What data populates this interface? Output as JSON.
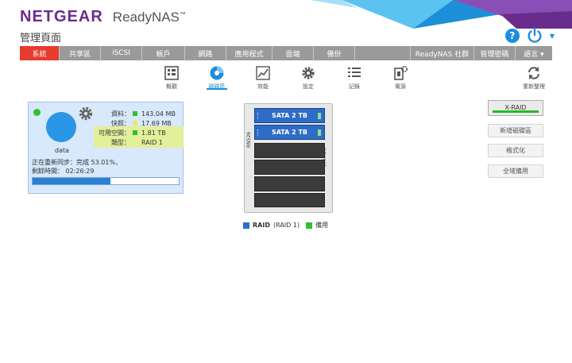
{
  "brand": {
    "logo": "NETGEAR",
    "product": "ReadyNAS",
    "tm": "™"
  },
  "page_title": "管理頁面",
  "colors": {
    "accent": "#e63b2e",
    "brand": "#6a2c8c",
    "blue": "#1b8de0",
    "green": "#2fc12f"
  },
  "nav": {
    "tabs": [
      {
        "label": "系統",
        "active": true
      },
      {
        "label": "共享區"
      },
      {
        "label": "iSCSI"
      },
      {
        "label": "帳戶"
      },
      {
        "label": "網路"
      },
      {
        "label": "應用程式"
      },
      {
        "label": "雲端"
      },
      {
        "label": "備份"
      }
    ],
    "right_tabs": [
      {
        "label": "ReadyNAS 社群"
      },
      {
        "label": "管理密碼"
      },
      {
        "label": "語言 ▾"
      }
    ]
  },
  "subnav": {
    "items": [
      {
        "label": "概觀",
        "icon": "overview-icon"
      },
      {
        "label": "磁碟區",
        "icon": "volume-icon",
        "active": true
      },
      {
        "label": "效能",
        "icon": "performance-icon"
      },
      {
        "label": "設定",
        "icon": "settings-icon"
      },
      {
        "label": "記錄",
        "icon": "logs-icon"
      },
      {
        "label": "電源",
        "icon": "power-settings-icon"
      }
    ],
    "refresh_label": "重新整理"
  },
  "volume": {
    "name": "data",
    "stats": [
      {
        "key": "資料：",
        "value": "143.04 MB",
        "color": "#2fc12f"
      },
      {
        "key": "快照：",
        "value": "17.69 MB",
        "color": "#e8e86a"
      },
      {
        "key": "可用空間：",
        "value": "1.81 TB",
        "color": "#2fc12f"
      },
      {
        "key": "類型：",
        "value": "RAID 1"
      }
    ],
    "sync_line1": "正在重新同步：完成 53.01%，",
    "sync_line2": "剩餘時間： 02:26:29",
    "progress": 0.5301
  },
  "chassis": {
    "model": "RN526",
    "side": "Internal",
    "disks": [
      "SATA 2 TB",
      "SATA 2 TB"
    ],
    "empty_bays": 4
  },
  "legend": {
    "raid_label": "RAID",
    "raid_paren": "(RAID 1)",
    "spare": "備用",
    "raid_color": "#2d6cc7",
    "spare_color": "#2fc12f"
  },
  "actions": {
    "xraid": "X-RAID",
    "new_volume": "新增磁碟區",
    "format": "格式化",
    "global_spare": "全域備用"
  }
}
